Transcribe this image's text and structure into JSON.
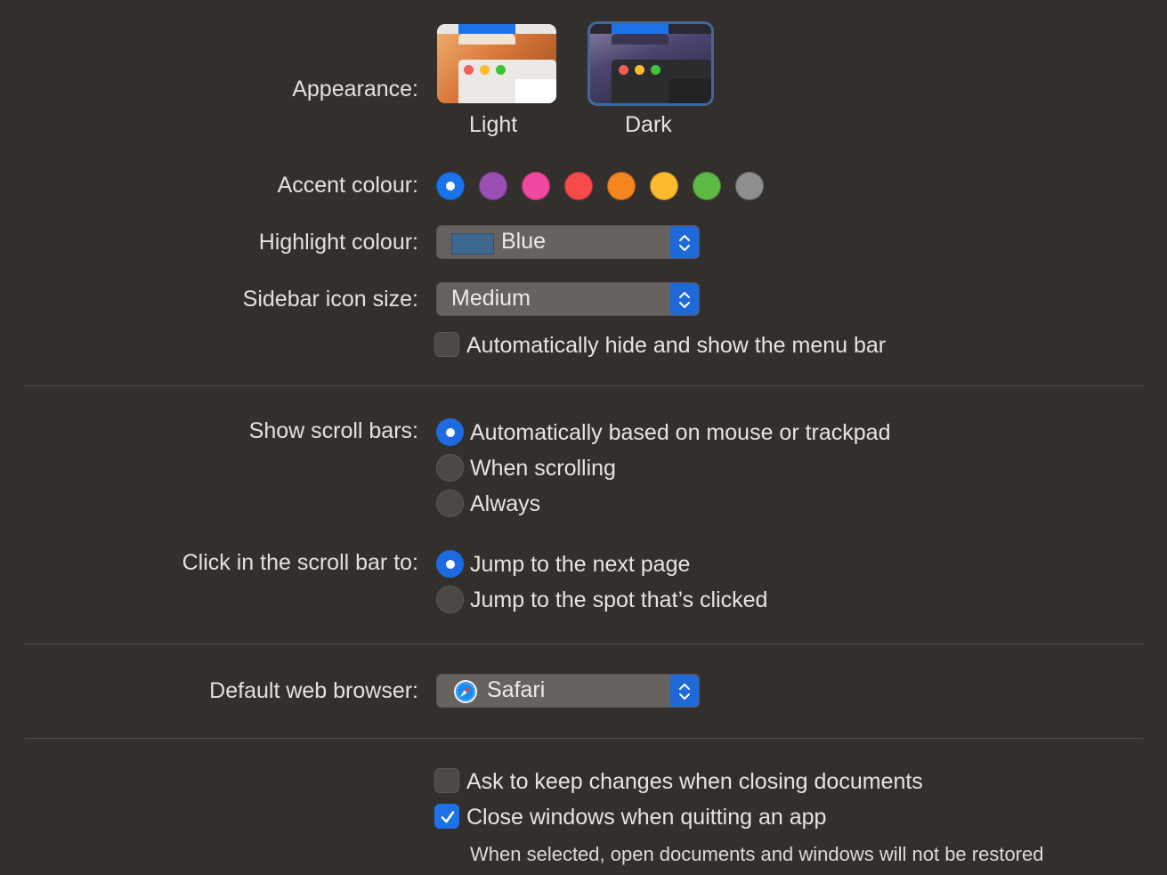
{
  "appearance": {
    "label": "Appearance:",
    "options": [
      {
        "name": "Light",
        "selected": false
      },
      {
        "name": "Dark",
        "selected": true
      }
    ]
  },
  "accent": {
    "label": "Accent colour:",
    "colors": [
      "#1a73e8",
      "#9b4fb5",
      "#f0489e",
      "#f44a4a",
      "#f5851f",
      "#fbb92e",
      "#5cb943",
      "#8e8e8e"
    ],
    "selected_index": 0
  },
  "highlight": {
    "label": "Highlight colour:",
    "value": "Blue",
    "swatch_color": "#3f6890"
  },
  "sidebar_icon": {
    "label": "Sidebar icon size:",
    "value": "Medium"
  },
  "menubar": {
    "label": "Automatically hide and show the menu bar",
    "checked": false
  },
  "scroll_bars": {
    "label": "Show scroll bars:",
    "options": [
      {
        "label": "Automatically based on mouse or trackpad",
        "selected": true
      },
      {
        "label": "When scrolling",
        "selected": false
      },
      {
        "label": "Always",
        "selected": false
      }
    ]
  },
  "click_scroll": {
    "label": "Click in the scroll bar to:",
    "options": [
      {
        "label": "Jump to the next page",
        "selected": true
      },
      {
        "label": "Jump to the spot that’s clicked",
        "selected": false
      }
    ]
  },
  "browser": {
    "label": "Default web browser:",
    "value": "Safari",
    "icon": "safari-icon"
  },
  "documents": {
    "ask_keep": {
      "label": "Ask to keep changes when closing documents",
      "checked": false
    },
    "close_windows": {
      "label": "Close windows when quitting an app",
      "checked": true
    },
    "note": "When selected, open documents and windows will not be restored"
  }
}
